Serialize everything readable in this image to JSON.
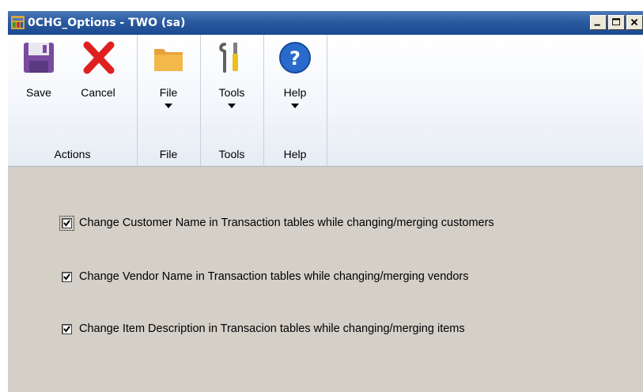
{
  "window": {
    "title": "0CHG_Options  -  TWO (sa)",
    "controls": [
      "minimize-button",
      "maximize-button",
      "close-button"
    ]
  },
  "ribbon": {
    "groups": [
      {
        "label": "Actions",
        "buttons": [
          {
            "label": "Save",
            "icon": "save-icon"
          },
          {
            "label": "Cancel",
            "icon": "cancel-icon"
          }
        ]
      },
      {
        "label": "File",
        "buttons": [
          {
            "label": "File",
            "icon": "folder-icon",
            "dropdown": true
          }
        ]
      },
      {
        "label": "Tools",
        "buttons": [
          {
            "label": "Tools",
            "icon": "tools-icon",
            "dropdown": true
          }
        ]
      },
      {
        "label": "Help",
        "buttons": [
          {
            "label": "Help",
            "icon": "help-icon",
            "dropdown": true
          }
        ]
      }
    ]
  },
  "options": [
    {
      "label": "Change Customer Name in Transaction tables while changing/merging customers",
      "checked": true
    },
    {
      "label": "Change Vendor Name in Transaction tables while changing/merging vendors",
      "checked": true
    },
    {
      "label": "Change Item Description in Transacion tables while changing/merging items",
      "checked": true
    }
  ],
  "colors": {
    "titlebar": "#2a5aa0",
    "window_bg": "#d4d0c8",
    "ribbon_bg": "#f3f6fb"
  }
}
